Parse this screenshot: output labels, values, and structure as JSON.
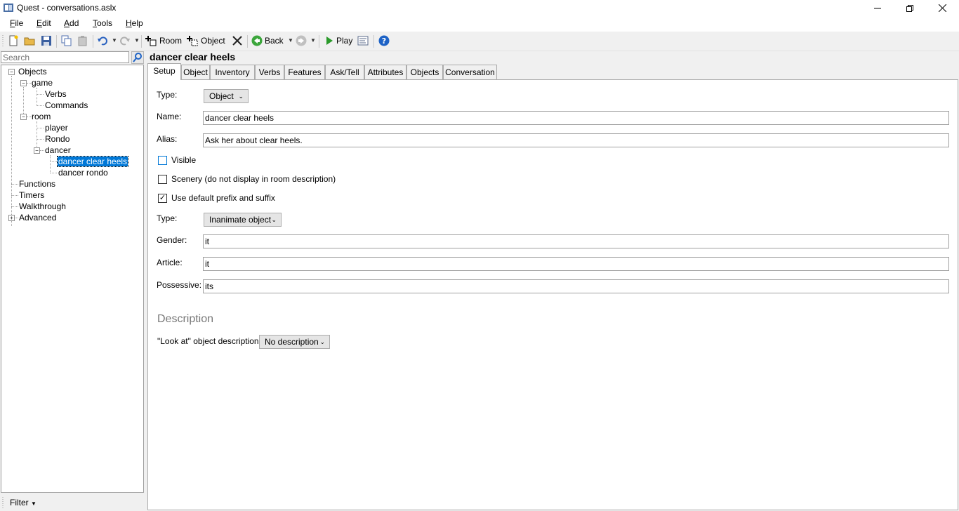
{
  "window": {
    "title": "Quest - conversations.aslx"
  },
  "menu": [
    {
      "key": "F",
      "rest": "ile"
    },
    {
      "key": "E",
      "rest": "dit"
    },
    {
      "key": "A",
      "rest": "dd"
    },
    {
      "key": "T",
      "rest": "ools"
    },
    {
      "key": "H",
      "rest": "elp"
    }
  ],
  "toolbar": {
    "room_label": "Room",
    "object_label": "Object",
    "back_label": "Back",
    "play_label": "Play"
  },
  "search": {
    "placeholder": "Search"
  },
  "tree": {
    "objects": "Objects",
    "game": "game",
    "verbs": "Verbs",
    "commands": "Commands",
    "room": "room",
    "player": "player",
    "rondo": "Rondo",
    "dancer": "dancer",
    "dancer_clear_heels": "dancer clear heels",
    "dancer_rondo": "dancer rondo",
    "functions": "Functions",
    "timers": "Timers",
    "walkthrough": "Walkthrough",
    "advanced": "Advanced"
  },
  "filter": {
    "label": "Filter"
  },
  "object_title": "dancer clear heels",
  "tabs": [
    "Setup",
    "Object",
    "Inventory",
    "Verbs",
    "Features",
    "Ask/Tell",
    "Attributes",
    "Objects",
    "Conversation"
  ],
  "setup": {
    "type_label": "Type:",
    "type_value": "Object",
    "name_label": "Name:",
    "name_value": "dancer clear heels",
    "alias_label": "Alias:",
    "alias_value": "Ask her about clear heels.",
    "visible_label": "Visible",
    "visible_checked": false,
    "scenery_label": "Scenery (do not display in room description)",
    "scenery_checked": false,
    "prefix_label": "Use default prefix and suffix",
    "prefix_checked": true,
    "type2_label": "Type:",
    "type2_value": "Inanimate object",
    "gender_label": "Gender:",
    "gender_value": "it",
    "article_label": "Article:",
    "article_value": "it",
    "possessive_label": "Possessive:",
    "possessive_value": "its",
    "description_heading": "Description",
    "look_label": "\"Look at\" object description:",
    "look_value": "No description"
  }
}
